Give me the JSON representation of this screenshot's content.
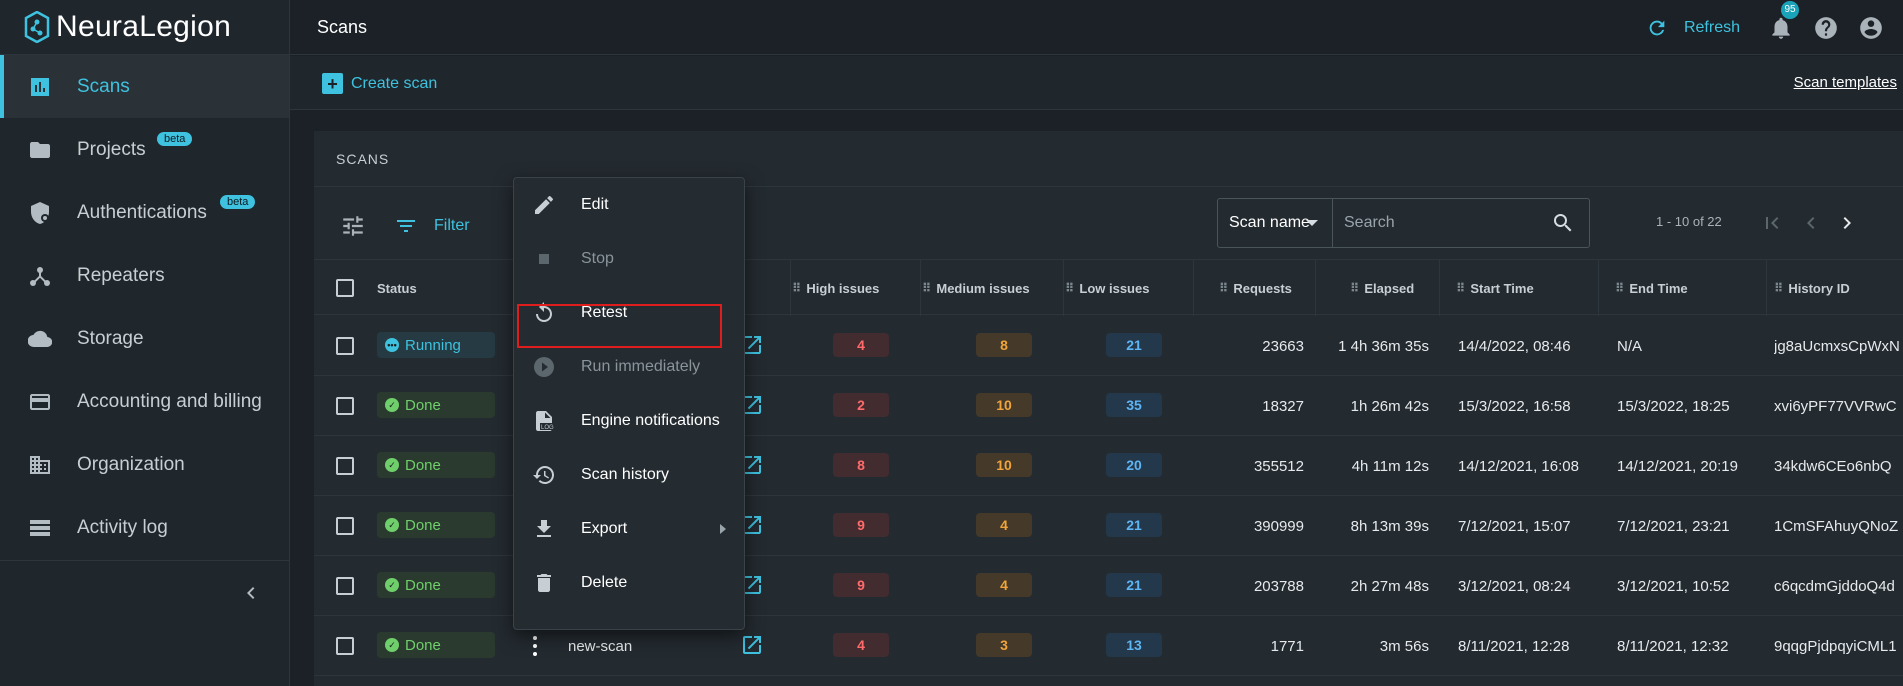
{
  "brand": {
    "name": "NeuraLegion"
  },
  "sidebar": {
    "items": [
      {
        "label": "Scans",
        "icon": "bar-chart-icon",
        "active": true
      },
      {
        "label": "Projects",
        "icon": "folder-icon",
        "badge": "beta"
      },
      {
        "label": "Authentications",
        "icon": "shield-lock-icon",
        "badge": "beta"
      },
      {
        "label": "Repeaters",
        "icon": "repeater-icon"
      },
      {
        "label": "Storage",
        "icon": "cloud-icon"
      },
      {
        "label": "Accounting and billing",
        "icon": "credit-card-icon"
      },
      {
        "label": "Organization",
        "icon": "building-icon"
      },
      {
        "label": "Activity log",
        "icon": "list-icon"
      }
    ]
  },
  "header": {
    "title": "Scans",
    "refresh_label": "Refresh",
    "notification_count": "95"
  },
  "toolbar": {
    "create_scan_label": "Create scan",
    "scan_templates_label": "Scan templates"
  },
  "scans_card": {
    "title": "SCANS",
    "filter_label": "Filter",
    "search_field_select": "Scan name",
    "search_placeholder": "Search",
    "pagination_label": "1 - 10 of 22"
  },
  "table": {
    "columns": {
      "status": "Status",
      "high": "High issues",
      "medium": "Medium issues",
      "low": "Low issues",
      "requests": "Requests",
      "elapsed": "Elapsed",
      "start": "Start Time",
      "end": "End Time",
      "history": "History ID"
    },
    "rows": [
      {
        "status": "Running",
        "name": "",
        "high": "4",
        "medium": "8",
        "low": "21",
        "requests": "23663",
        "elapsed": "1 4h 36m 35s",
        "start": "14/4/2022, 08:46",
        "end": "N/A",
        "history": "jg8aUcmxsCpWxN"
      },
      {
        "status": "Done",
        "name": "",
        "high": "2",
        "medium": "10",
        "low": "35",
        "requests": "18327",
        "elapsed": "1h 26m 42s",
        "start": "15/3/2022, 16:58",
        "end": "15/3/2022, 18:25",
        "history": "xvi6yPF77VVRwC"
      },
      {
        "status": "Done",
        "name": "",
        "high": "8",
        "medium": "10",
        "low": "20",
        "requests": "355512",
        "elapsed": "4h 11m 12s",
        "start": "14/12/2021, 16:08",
        "end": "14/12/2021, 20:19",
        "history": "34kdw6CEo6nbQ"
      },
      {
        "status": "Done",
        "name": "",
        "high": "9",
        "medium": "4",
        "low": "21",
        "requests": "390999",
        "elapsed": "8h 13m 39s",
        "start": "7/12/2021, 15:07",
        "end": "7/12/2021, 23:21",
        "history": "1CmSFAhuyQNoZ"
      },
      {
        "status": "Done",
        "name": "",
        "high": "9",
        "medium": "4",
        "low": "21",
        "requests": "203788",
        "elapsed": "2h 27m 48s",
        "start": "3/12/2021, 08:24",
        "end": "3/12/2021, 10:52",
        "history": "c6qcdmGjddoQ4d"
      },
      {
        "status": "Done",
        "name": "new-scan",
        "high": "4",
        "medium": "3",
        "low": "13",
        "requests": "1771",
        "elapsed": "3m 56s",
        "start": "8/11/2021, 12:28",
        "end": "8/11/2021, 12:32",
        "history": "9qqgPjdpqyiCML1"
      }
    ]
  },
  "context_menu": {
    "items": [
      {
        "label": "Edit",
        "icon": "pencil-icon",
        "disabled": false
      },
      {
        "label": "Stop",
        "icon": "stop-icon",
        "disabled": true
      },
      {
        "label": "Retest",
        "icon": "retest-icon",
        "disabled": false,
        "highlighted": true
      },
      {
        "label": "Run immediately",
        "icon": "play-circle-icon",
        "disabled": true
      },
      {
        "label": "Engine notifications",
        "icon": "log-file-icon",
        "disabled": false
      },
      {
        "label": "Scan history",
        "icon": "history-icon",
        "disabled": false
      },
      {
        "label": "Export",
        "icon": "download-icon",
        "disabled": false,
        "submenu": true
      },
      {
        "label": "Delete",
        "icon": "trash-icon",
        "disabled": false
      }
    ]
  },
  "colors": {
    "accent": "#3ec2df",
    "background": "#1b2126",
    "high": "#ff6b6b",
    "medium": "#f0a43a",
    "low": "#5fb4f2",
    "done": "#6fcf6a",
    "highlight_box": "#e01d1d"
  }
}
